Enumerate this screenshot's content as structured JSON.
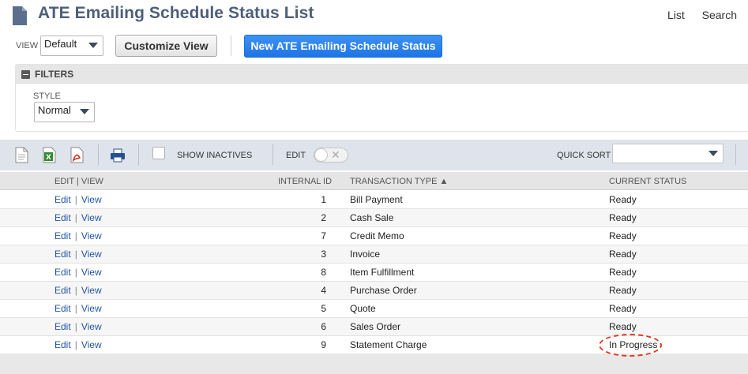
{
  "header": {
    "title": "ATE Emailing Schedule Status List",
    "links": [
      "List",
      "Search"
    ]
  },
  "toolbar": {
    "view_label": "VIEW",
    "view_value": "Default",
    "customize_label": "Customize View",
    "new_label": "New ATE Emailing Schedule Status"
  },
  "filters": {
    "title": "FILTERS",
    "style_label": "STYLE",
    "style_value": "Normal"
  },
  "listbar": {
    "show_inactives": "SHOW INACTIVES",
    "edit_label": "EDIT",
    "quick_sort": "QUICK SORT",
    "quick_sort_value": ""
  },
  "table": {
    "columns": [
      "EDIT | VIEW",
      "INTERNAL ID",
      "TRANSACTION TYPE ▲",
      "CURRENT STATUS"
    ],
    "edit_text": "Edit",
    "view_text": "View",
    "rows": [
      {
        "id": "1",
        "type": "Bill Payment",
        "status": "Ready"
      },
      {
        "id": "2",
        "type": "Cash Sale",
        "status": "Ready"
      },
      {
        "id": "7",
        "type": "Credit Memo",
        "status": "Ready"
      },
      {
        "id": "3",
        "type": "Invoice",
        "status": "Ready"
      },
      {
        "id": "8",
        "type": "Item Fulfillment",
        "status": "Ready"
      },
      {
        "id": "4",
        "type": "Purchase Order",
        "status": "Ready"
      },
      {
        "id": "5",
        "type": "Quote",
        "status": "Ready"
      },
      {
        "id": "6",
        "type": "Sales Order",
        "status": "Ready"
      },
      {
        "id": "9",
        "type": "Statement Charge",
        "status": "In Progress"
      }
    ]
  },
  "colors": {
    "title": "#4d5f79",
    "primary_button": "#1e74e6",
    "link": "#2255a4",
    "highlight": "#e03a1e"
  }
}
